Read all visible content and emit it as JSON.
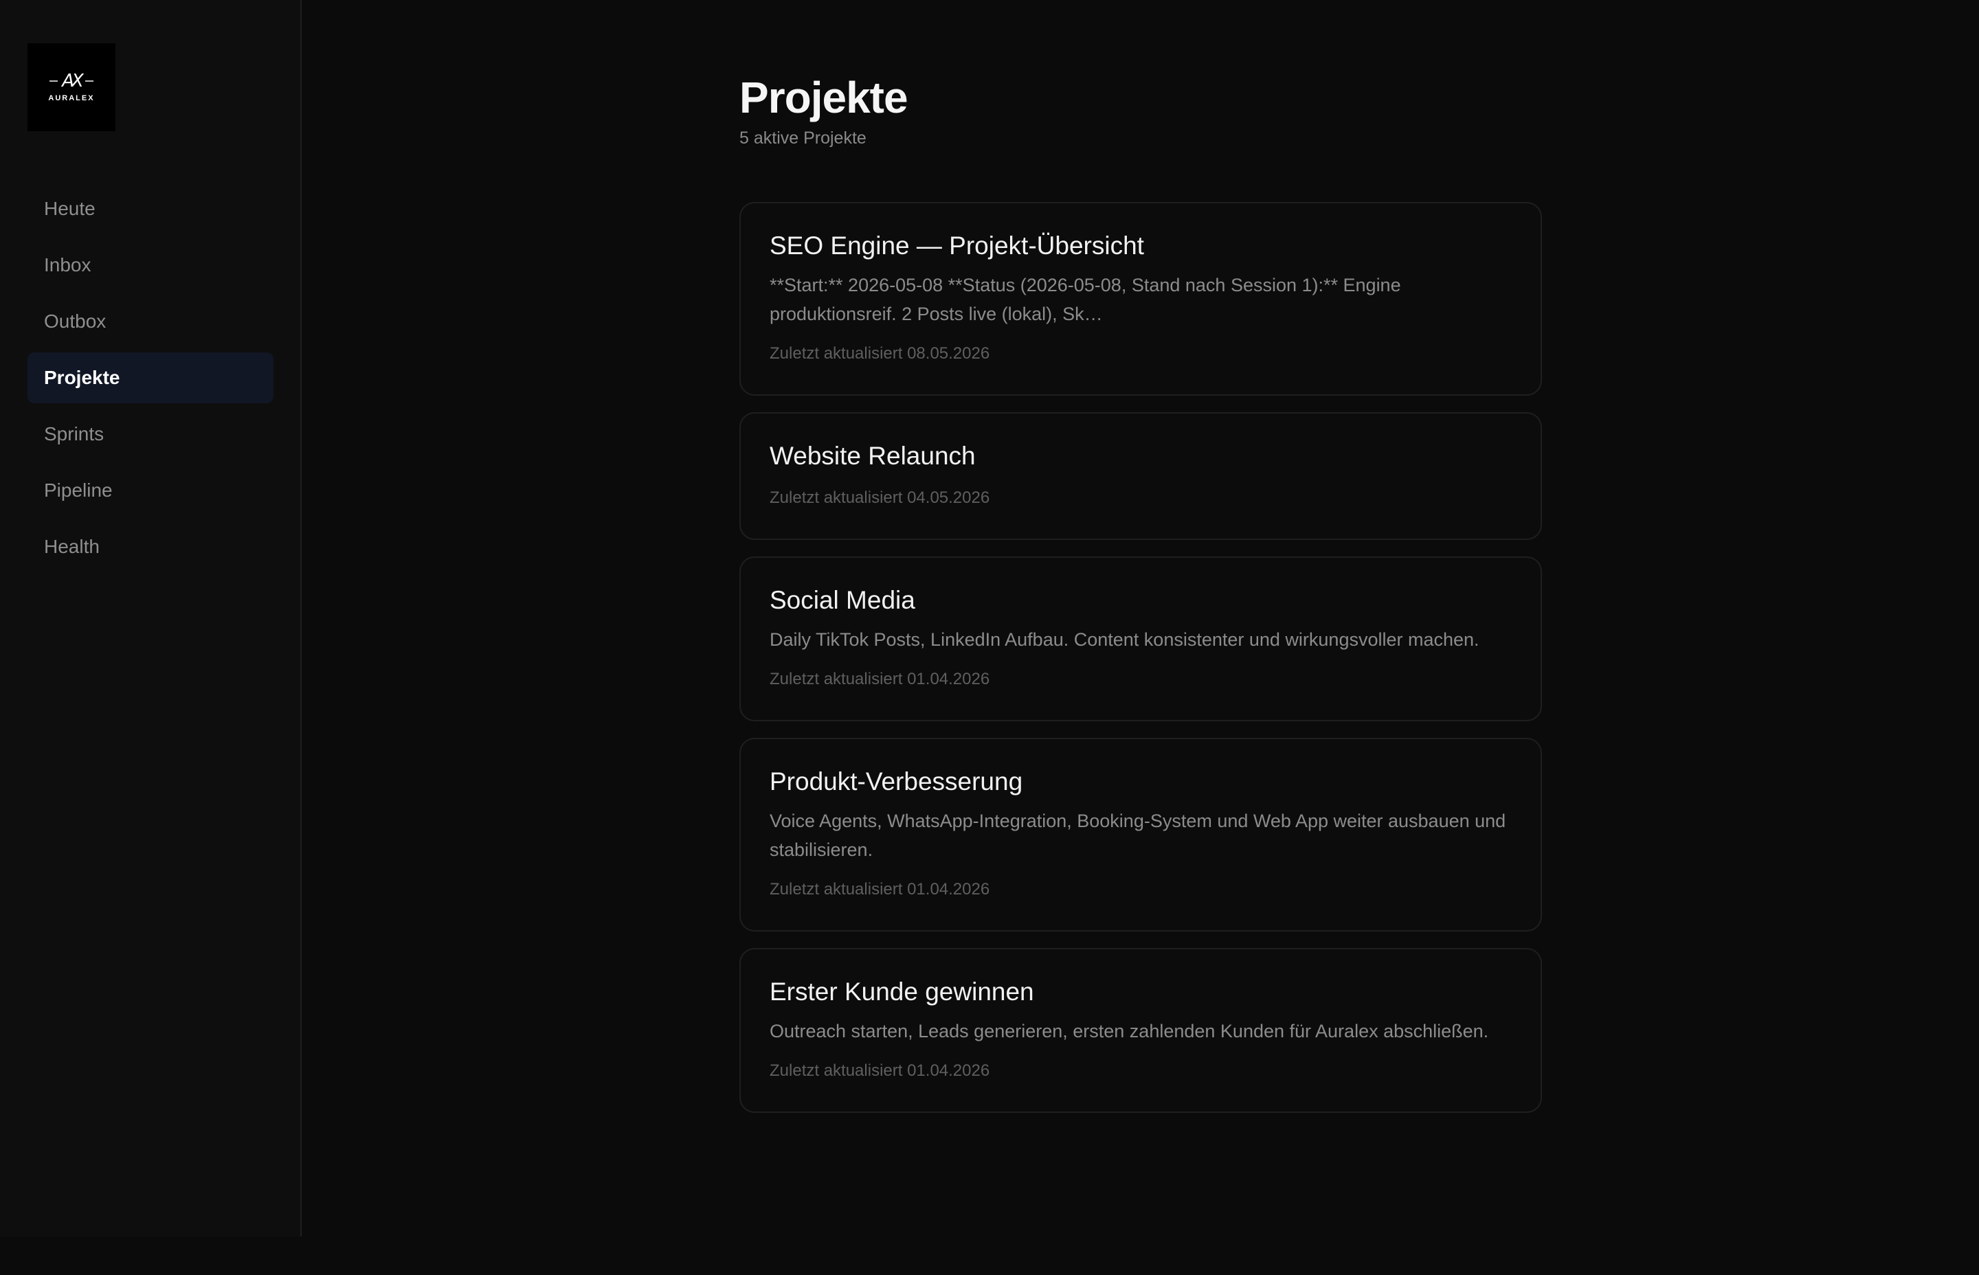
{
  "brand": {
    "logo_mark": "AX",
    "logo_text": "AURALEX"
  },
  "sidebar": {
    "items": [
      {
        "label": "Heute"
      },
      {
        "label": "Inbox"
      },
      {
        "label": "Outbox"
      },
      {
        "label": "Projekte"
      },
      {
        "label": "Sprints"
      },
      {
        "label": "Pipeline"
      },
      {
        "label": "Health"
      }
    ],
    "active": "Projekte"
  },
  "main": {
    "title": "Projekte",
    "subtitle": "5 aktive Projekte",
    "projects": [
      {
        "title": "SEO Engine — Projekt-Übersicht",
        "description": "**Start:** 2026-05-08 **Status (2026-05-08, Stand nach Session 1):** Engine produktionsreif. 2 Posts live (lokal), Sk…",
        "updated": "Zuletzt aktualisiert 08.05.2026"
      },
      {
        "title": "Website Relaunch",
        "description": "",
        "updated": "Zuletzt aktualisiert 04.05.2026"
      },
      {
        "title": "Social Media",
        "description": "Daily TikTok Posts, LinkedIn Aufbau. Content konsistenter und wirkungsvoller machen.",
        "updated": "Zuletzt aktualisiert 01.04.2026"
      },
      {
        "title": "Produkt-Verbesserung",
        "description": "Voice Agents, WhatsApp-Integration, Booking-System und Web App weiter ausbauen und stabilisieren.",
        "updated": "Zuletzt aktualisiert 01.04.2026"
      },
      {
        "title": "Erster Kunde gewinnen",
        "description": "Outreach starten, Leads generieren, ersten zahlenden Kunden für Auralex abschließen.",
        "updated": "Zuletzt aktualisiert 01.04.2026"
      }
    ]
  },
  "colors": {
    "background": "#0b0b0b",
    "sidebar_background": "#0e0e0e",
    "active_nav_background": "#111725",
    "card_border": "#1f1f1f",
    "text_primary": "#f2f2f2",
    "text_secondary": "#8c8c8c",
    "text_muted": "#5f5f5f"
  }
}
